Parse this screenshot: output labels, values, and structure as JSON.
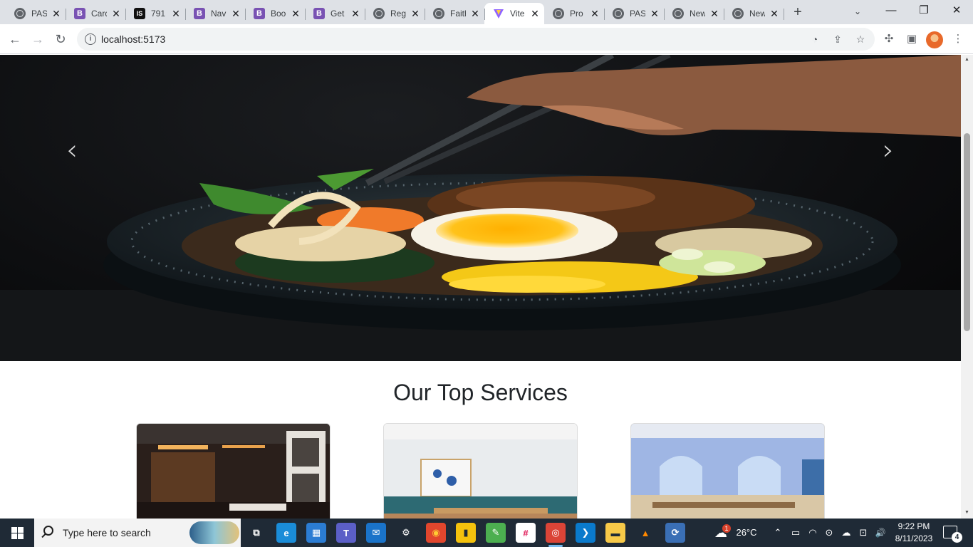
{
  "browser": {
    "tabs": [
      {
        "title": "PAS",
        "favicon": "globe-icon",
        "active": false
      },
      {
        "title": "Card",
        "favicon": "bootstrap-icon",
        "active": false
      },
      {
        "title": "791",
        "favicon": "is-icon",
        "active": false
      },
      {
        "title": "Nav",
        "favicon": "bootstrap-icon",
        "active": false
      },
      {
        "title": "Boo",
        "favicon": "bootstrap-icon",
        "active": false
      },
      {
        "title": "Get",
        "favicon": "bootstrap-icon",
        "active": false
      },
      {
        "title": "Reg",
        "favicon": "globe-icon",
        "active": false
      },
      {
        "title": "Faith",
        "favicon": "globe-icon",
        "active": false
      },
      {
        "title": "Vite",
        "favicon": "vite-icon",
        "active": true
      },
      {
        "title": "Pro",
        "favicon": "globe-icon",
        "active": false
      },
      {
        "title": "PAS",
        "favicon": "globe-icon",
        "active": false
      },
      {
        "title": "New",
        "favicon": "globe-icon",
        "active": false
      },
      {
        "title": "New",
        "favicon": "globe-icon",
        "active": false
      }
    ],
    "favicon_glyphs": {
      "bootstrap": "B",
      "is": "IS"
    },
    "new_tab_glyph": "+",
    "close_glyph": "✕",
    "window_controls": {
      "minimize": "—",
      "maximize": "❐",
      "close": "✕",
      "tab_search": "⌄"
    },
    "nav": {
      "back": "←",
      "forward": "→",
      "reload": "↻"
    },
    "address": {
      "url": "localhost:5173",
      "info_glyph": "i"
    },
    "omnibox_icons": {
      "performance": "◔",
      "share": "⇪",
      "bookmark": "☆"
    },
    "toolbar_icons": {
      "extensions": "✣",
      "side_panel": "▣",
      "menu": "⋮"
    }
  },
  "page": {
    "carousel": {
      "prev_glyph": "‹",
      "next_glyph": "›"
    },
    "services_title": "Our Top Services",
    "scrollbar": {
      "up": "▲",
      "down": "▼"
    }
  },
  "taskbar": {
    "search_placeholder": "Type here to search",
    "apps": [
      {
        "name": "task-view",
        "glyph": "⧉",
        "color": "#ffffff",
        "bg": "transparent"
      },
      {
        "name": "edge",
        "glyph": "e",
        "color": "#ffffff",
        "bg": "#1a8cd8"
      },
      {
        "name": "store",
        "glyph": "▦",
        "color": "#ffffff",
        "bg": "#2b7cd3"
      },
      {
        "name": "teams",
        "glyph": "T",
        "color": "#ffffff",
        "bg": "#5b5fc7"
      },
      {
        "name": "mail",
        "glyph": "✉",
        "color": "#ffffff",
        "bg": "#1a73c9"
      },
      {
        "name": "settings",
        "glyph": "⚙",
        "color": "#ffffff",
        "bg": "transparent"
      },
      {
        "name": "firefox",
        "glyph": "◉",
        "color": "#ffcc33",
        "bg": "#e1462d"
      },
      {
        "name": "sheets",
        "glyph": "▮",
        "color": "#1f2a36",
        "bg": "#f4c20d"
      },
      {
        "name": "paint",
        "glyph": "✎",
        "color": "#ffffff",
        "bg": "#4caf50"
      },
      {
        "name": "slack",
        "glyph": "#",
        "color": "#e01e5a",
        "bg": "#ffffff"
      },
      {
        "name": "chrome",
        "glyph": "◎",
        "color": "#ffffff",
        "bg": "#db4437"
      },
      {
        "name": "vscode",
        "glyph": "❯",
        "color": "#ffffff",
        "bg": "#0a7acc"
      },
      {
        "name": "file-explorer",
        "glyph": "▬",
        "color": "#1f2a36",
        "bg": "#f7c948"
      },
      {
        "name": "vlc",
        "glyph": "▲",
        "color": "#ff8800",
        "bg": "transparent"
      },
      {
        "name": "postman",
        "glyph": "⟳",
        "color": "#ffffff",
        "bg": "#3a6fb5"
      }
    ],
    "weather": {
      "temp": "26°C",
      "badge": "1"
    },
    "tray": {
      "chevron": "⌃",
      "battery": "▭",
      "wifi": "◠",
      "meet": "⊙",
      "onedrive": "☁",
      "network": "⊡",
      "volume": "🔊"
    },
    "clock": {
      "time": "9:22 PM",
      "date": "8/11/2023"
    },
    "notifications": "4"
  }
}
